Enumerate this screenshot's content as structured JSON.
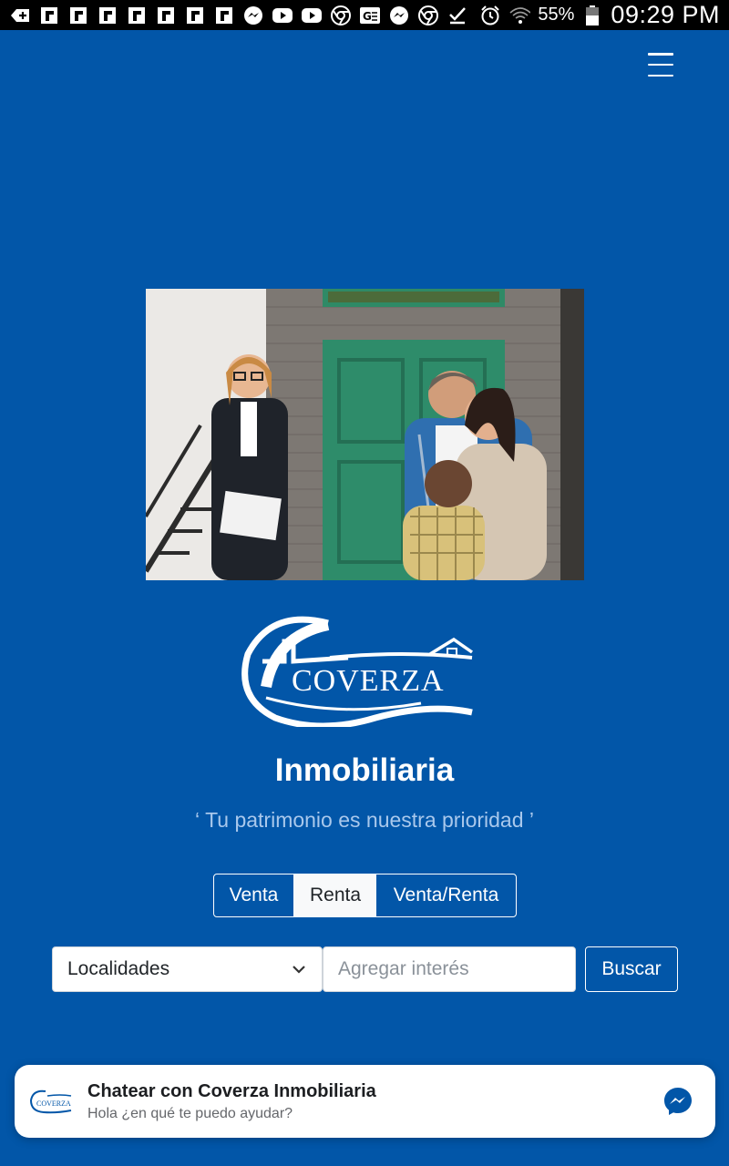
{
  "status_bar": {
    "battery_text": "55%",
    "time": "09:29 PM",
    "notification_icons": [
      "add-icon",
      "flipboard-icon",
      "flipboard-icon",
      "flipboard-icon",
      "flipboard-icon",
      "flipboard-icon",
      "flipboard-icon",
      "flipboard-icon",
      "messenger-icon",
      "youtube-icon",
      "youtube-icon",
      "chrome-icon",
      "translate-icon",
      "messenger-icon",
      "chrome-icon",
      "download-done-icon"
    ]
  },
  "brand": {
    "logo_text": "COVERZA",
    "title": "Inmobiliaria",
    "tagline": "‘ Tu patrimonio es nuestra prioridad ’",
    "primary_color": "#0256a8"
  },
  "tabs": [
    {
      "label": "Venta",
      "active": false
    },
    {
      "label": "Renta",
      "active": true
    },
    {
      "label": "Venta/Renta",
      "active": false
    }
  ],
  "search": {
    "location_select": "Localidades",
    "interest_placeholder": "Agregar interés",
    "button_label": "Buscar"
  },
  "chat": {
    "title": "Chatear con Coverza Inmobiliaria",
    "subtitle": "Hola ¿en qué te puedo ayudar?",
    "avatar_text": "COVERZA"
  }
}
